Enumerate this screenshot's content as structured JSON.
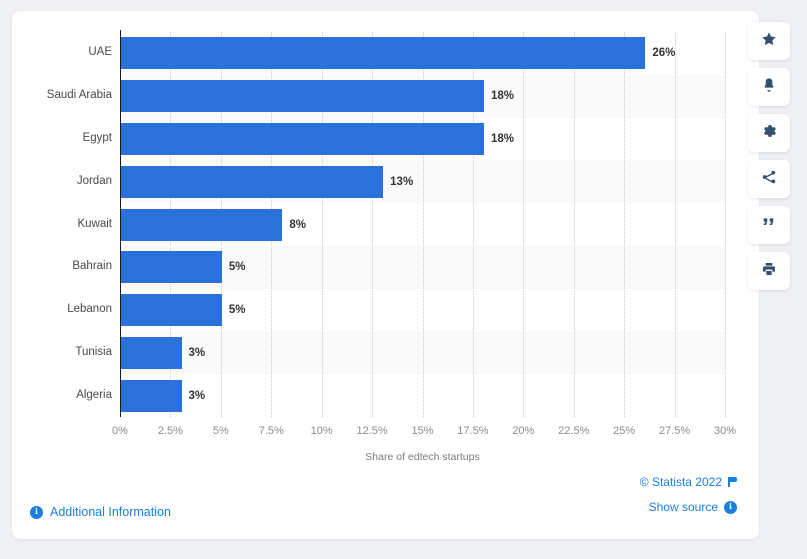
{
  "chart_data": {
    "type": "bar",
    "orientation": "horizontal",
    "title": "",
    "xlabel": "Share of edtech startups",
    "ylabel": "",
    "xlim": [
      0,
      30
    ],
    "grid": true,
    "legend": false,
    "bar_color": "#2a72d9",
    "categories": [
      "UAE",
      "Saudi Arabia",
      "Egypt",
      "Jordan",
      "Kuwait",
      "Bahrain",
      "Lebanon",
      "Tunisia",
      "Algeria"
    ],
    "values": [
      26,
      18,
      18,
      13,
      8,
      5,
      5,
      3,
      3
    ],
    "value_labels": [
      "26%",
      "18%",
      "18%",
      "13%",
      "8%",
      "5%",
      "5%",
      "3%",
      "3%"
    ],
    "xticks": [
      0,
      2.5,
      5,
      7.5,
      10,
      12.5,
      15,
      17.5,
      20,
      22.5,
      25,
      27.5,
      30
    ],
    "xtick_labels": [
      "0%",
      "2.5%",
      "5%",
      "7.5%",
      "10%",
      "12.5%",
      "15%",
      "17.5%",
      "20%",
      "22.5%",
      "25%",
      "27.5%",
      "30%"
    ]
  },
  "footer": {
    "additional_information": "Additional Information",
    "copyright": "© Statista 2022",
    "show_source": "Show source"
  },
  "toolbar": {
    "items": [
      {
        "name": "favorite",
        "icon": "star-icon"
      },
      {
        "name": "alert",
        "icon": "bell-icon"
      },
      {
        "name": "settings",
        "icon": "gear-icon"
      },
      {
        "name": "share",
        "icon": "share-icon"
      },
      {
        "name": "citation",
        "icon": "quote-icon"
      },
      {
        "name": "print",
        "icon": "print-icon"
      }
    ]
  }
}
